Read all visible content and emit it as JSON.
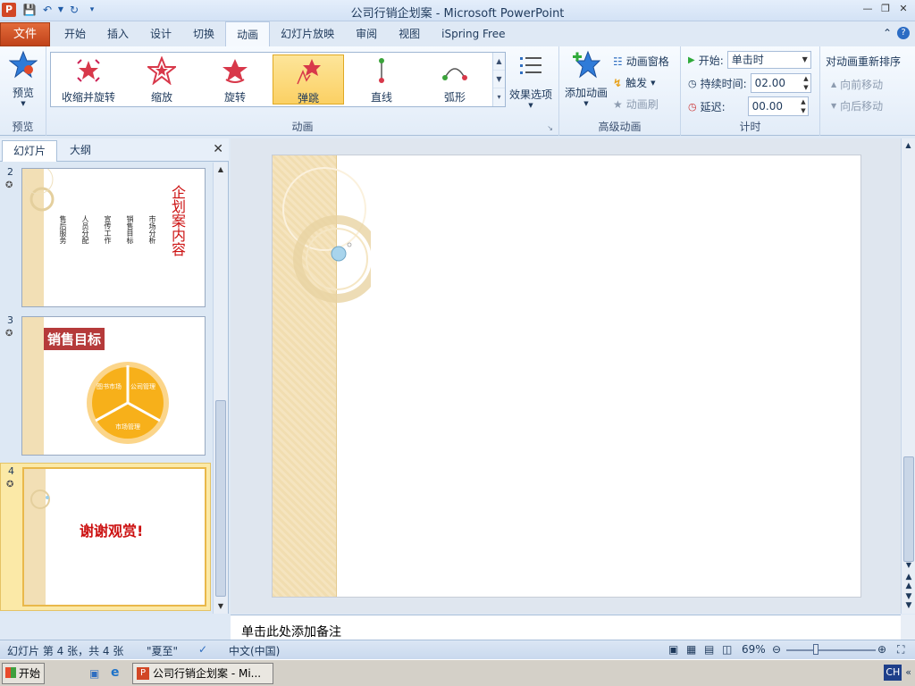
{
  "window": {
    "title": "公司行销企划案 - Microsoft PowerPoint",
    "app_icon": "P"
  },
  "tabs": {
    "file": "文件",
    "items": [
      "开始",
      "插入",
      "设计",
      "切换",
      "动画",
      "幻灯片放映",
      "审阅",
      "视图",
      "iSpring Free"
    ],
    "active": "动画"
  },
  "ribbon": {
    "preview": {
      "button": "预览",
      "group": "预览"
    },
    "animation_group": "动画",
    "gallery": [
      {
        "label": "收缩并旋转",
        "icon": "shrink-turn-icon"
      },
      {
        "label": "缩放",
        "icon": "zoom-icon"
      },
      {
        "label": "旋转",
        "icon": "spin-icon"
      },
      {
        "label": "弹跳",
        "icon": "bounce-icon"
      },
      {
        "label": "直线",
        "icon": "line-path-icon"
      },
      {
        "label": "弧形",
        "icon": "arc-path-icon"
      }
    ],
    "effect_options": "效果选项",
    "advanced": {
      "group": "高级动画",
      "add_animation": "添加动画",
      "animation_pane": "动画窗格",
      "trigger": "触发",
      "animation_painter": "动画刷"
    },
    "timing": {
      "group": "计时",
      "start_label": "开始:",
      "start_value": "单击时",
      "duration_label": "持续时间:",
      "duration_value": "02.00",
      "delay_label": "延迟:",
      "delay_value": "00.00"
    },
    "reorder": {
      "title": "对动画重新排序",
      "move_earlier": "向前移动",
      "move_later": "向后移动"
    }
  },
  "left_pane": {
    "tab_slides": "幻灯片",
    "tab_outline": "大纲",
    "slides": [
      {
        "num": "2",
        "title": "企划案内容",
        "bullets": [
          "售后服务",
          "人员分配",
          "宣传工作",
          "销售目标",
          "市场分析"
        ]
      },
      {
        "num": "3",
        "title": "销售目标",
        "segments": [
          "图书市场",
          "公司管理",
          "市场管理"
        ]
      },
      {
        "num": "4",
        "title": "谢谢观赏!"
      }
    ]
  },
  "notes": {
    "placeholder": "单击此处添加备注"
  },
  "status": {
    "slide_info": "幻灯片 第 4 张，共 4 张",
    "theme": "\"夏至\"",
    "language": "中文(中国)",
    "zoom": "69%"
  },
  "taskbar": {
    "start": "开始",
    "app": "公司行销企划案 - Mi...",
    "ime": "CH"
  },
  "colors": {
    "accent_orange": "#d24726",
    "slide_red": "#cc1111",
    "pie_orange": "#f7b01a",
    "beige": "#f2dfb5"
  }
}
